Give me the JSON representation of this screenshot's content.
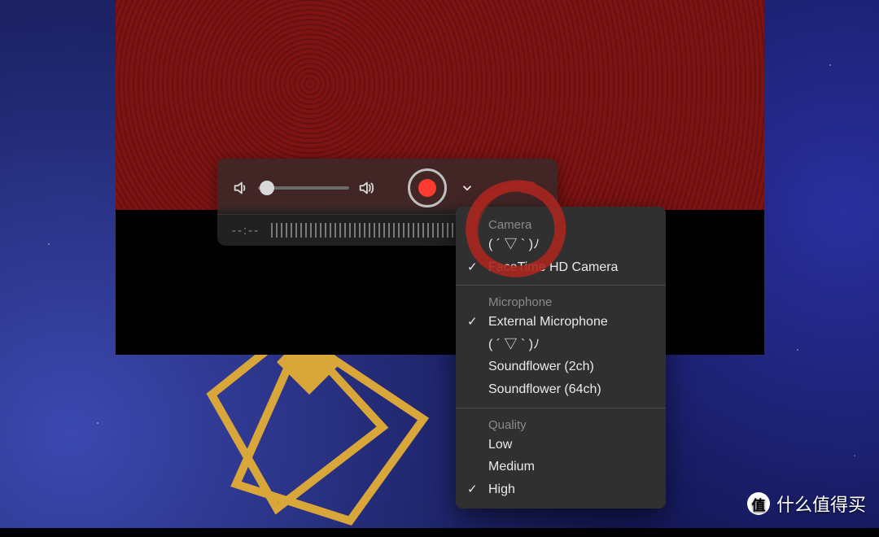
{
  "toolbar": {
    "time_placeholder": "--:--",
    "volume_percent": 10
  },
  "menu": {
    "sections": [
      {
        "header": "Camera",
        "items": [
          {
            "label": "( ´ ▽ ` )ﾉ",
            "checked": false
          },
          {
            "label": "FaceTime HD Camera",
            "checked": true
          }
        ]
      },
      {
        "header": "Microphone",
        "items": [
          {
            "label": "External Microphone",
            "checked": true
          },
          {
            "label": "( ´ ▽ ` )ﾉ",
            "checked": false
          },
          {
            "label": "Soundflower (2ch)",
            "checked": false
          },
          {
            "label": "Soundflower (64ch)",
            "checked": false
          }
        ]
      },
      {
        "header": "Quality",
        "items": [
          {
            "label": "Low",
            "checked": false
          },
          {
            "label": "Medium",
            "checked": false
          },
          {
            "label": "High",
            "checked": true
          }
        ]
      }
    ]
  },
  "watermark": {
    "badge_char": "值",
    "text": "什么值得买"
  }
}
